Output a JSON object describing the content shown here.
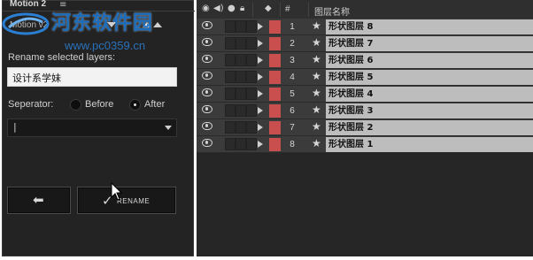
{
  "panel": {
    "title": "Motion 2",
    "menu_glyph": "≡",
    "subtitle": "Motion v2",
    "rename_label": "Rename selected layers:",
    "rename_value": "设计系学妹",
    "separator_label": "Seperator:",
    "radio_before": "Before",
    "radio_after": "After",
    "selected_radio": "After",
    "separator_value": "|",
    "back_glyph": "⬅",
    "rename_button": "RENAME",
    "rename_check": "✓"
  },
  "watermark": {
    "text": "河东软件园",
    "url": "www.pc0359.cn"
  },
  "layers": {
    "header": {
      "num_col": "#",
      "name_col": "图层名称",
      "icons": [
        "eye-icon",
        "audio-icon",
        "solo-icon",
        "lock-icon",
        "label-icon"
      ]
    },
    "label_color": "#c94f4f",
    "rows": [
      {
        "num": "1",
        "name": "形状图层 8"
      },
      {
        "num": "2",
        "name": "形状图层 7"
      },
      {
        "num": "3",
        "name": "形状图层 6"
      },
      {
        "num": "4",
        "name": "形状图层 5"
      },
      {
        "num": "5",
        "name": "形状图层 4"
      },
      {
        "num": "6",
        "name": "形状图层 3"
      },
      {
        "num": "7",
        "name": "形状图层 2"
      },
      {
        "num": "8",
        "name": "形状图层 1"
      }
    ]
  }
}
